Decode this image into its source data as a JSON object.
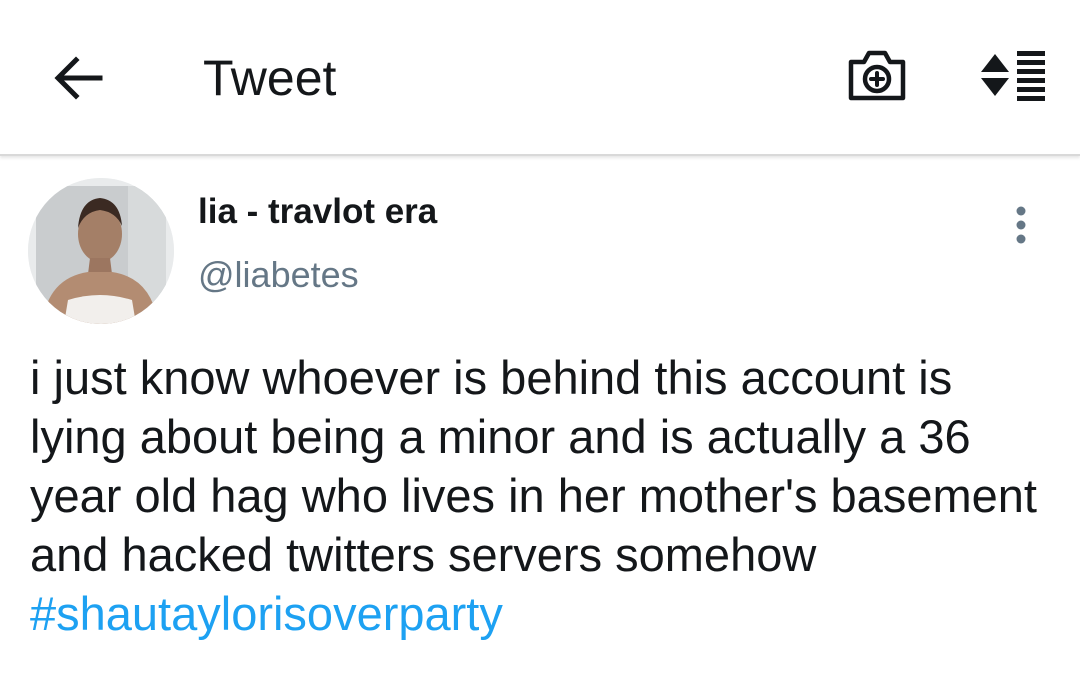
{
  "app_bar": {
    "title": "Tweet",
    "icons": {
      "back": "back-arrow-icon",
      "camera": "camera-plus-icon",
      "sort": "sort-list-icon"
    }
  },
  "tweet": {
    "author": {
      "display_name": "lia - travlot era",
      "handle": "@liabetes"
    },
    "more_icon": "more-vertical-icon",
    "text_body": "i just know whoever is behind this account is lying about being a minor and is actually a 36 year old hag who lives in her mother's basement and hacked twitters servers somehow",
    "hashtag": "#shautaylorisoverparty"
  },
  "colors": {
    "text_primary": "#14171a",
    "text_secondary": "#657786",
    "link": "#1da1f2",
    "divider": "#d9d9d9"
  }
}
